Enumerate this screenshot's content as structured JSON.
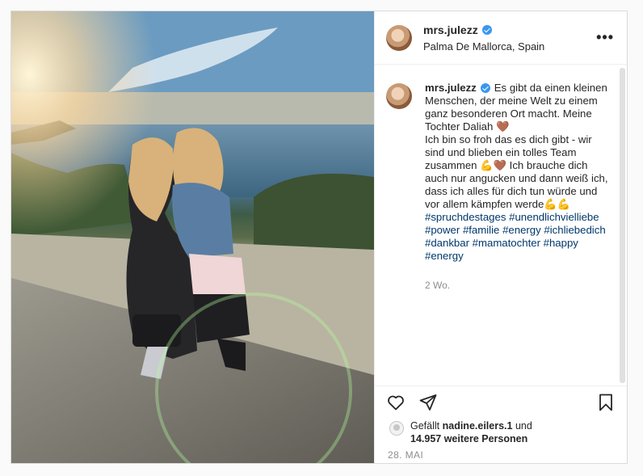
{
  "post": {
    "username": "mrs.julezz",
    "location": "Palma De Mallorca, Spain",
    "more_label": "•••"
  },
  "caption": {
    "username": "mrs.julezz",
    "line1": "Es gibt da einen kleinen Menschen, der meine Welt zu einem ganz besonderen Ort macht. Meine Tochter Daliah ",
    "heart1": "🤎",
    "line2": "Ich bin so froh das es dich gibt - wir sind und blieben ein tolles Team zusammen ",
    "emoji2": "💪🤎",
    "line3": " Ich brauche dich auch nur angucken und dann weiß ich, dass ich alles für dich tun würde und vor allem kämpfen werde",
    "emoji3": "💪💪",
    "hashtags": [
      "#spruchdestages",
      "#unendlichvielliebe",
      "#power",
      "#familie",
      "#energy",
      "#ichliebedich",
      "#dankbar",
      "#mamatochter",
      "#happy",
      "#energy"
    ],
    "time": "2 Wo."
  },
  "likes": {
    "prefix": "Gefällt ",
    "user": "nadine.eilers.1",
    "mid": " und",
    "count": "14.957 weitere Personen"
  },
  "date": "28. MAI",
  "icons": [
    "heart-icon",
    "share-icon",
    "bookmark-icon",
    "verified-icon",
    "more-icon"
  ],
  "colors": {
    "link": "#00376b",
    "verified": "#3897f0",
    "muted": "#8e8e8e"
  }
}
